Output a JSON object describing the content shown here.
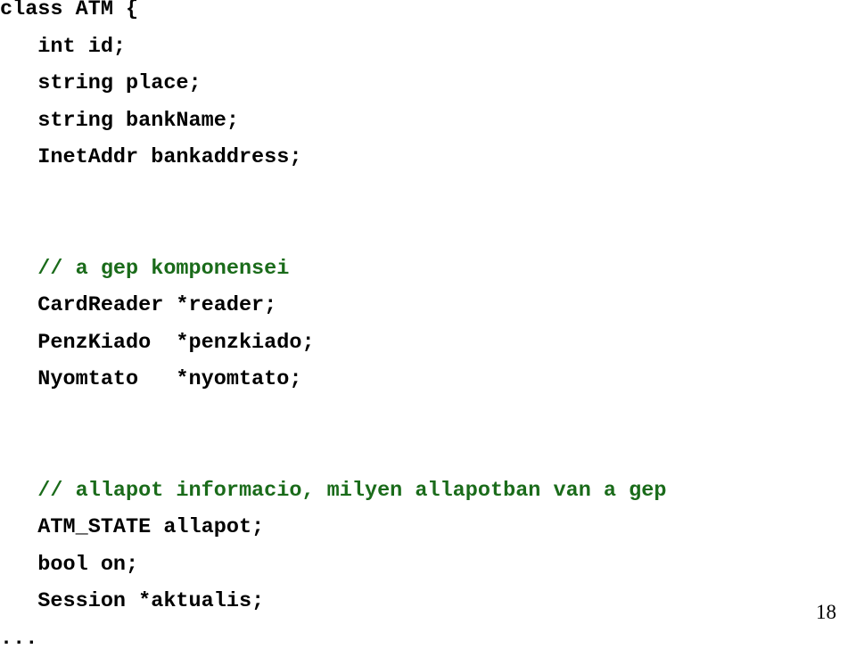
{
  "slide": {
    "background_color": "#ffffff",
    "text_color": "#000000",
    "comment_color": "#1a6b1a",
    "page_number": "18",
    "language": "cpp",
    "code_lines": [
      {
        "text": "class ATM {",
        "kind": "code"
      },
      {
        "text": "   int id;",
        "kind": "code"
      },
      {
        "text": "   string place;",
        "kind": "code"
      },
      {
        "text": "   string bankName;",
        "kind": "code"
      },
      {
        "text": "   InetAddr bankaddress;",
        "kind": "code"
      },
      {
        "text": " ",
        "kind": "blank"
      },
      {
        "text": " ",
        "kind": "blank"
      },
      {
        "text": "   // a gep komponensei",
        "kind": "comment"
      },
      {
        "text": "   CardReader *reader;",
        "kind": "code"
      },
      {
        "text": "   PenzKiado  *penzkiado;",
        "kind": "code"
      },
      {
        "text": "   Nyomtato   *nyomtato;",
        "kind": "code"
      },
      {
        "text": " ",
        "kind": "blank"
      },
      {
        "text": " ",
        "kind": "blank"
      },
      {
        "text": "   // allapot informacio, milyen allapotban van a gep",
        "kind": "comment"
      },
      {
        "text": "   ATM_STATE allapot;",
        "kind": "code"
      },
      {
        "text": "   bool on;",
        "kind": "code"
      },
      {
        "text": "   Session *aktualis;",
        "kind": "code"
      },
      {
        "text": "...",
        "kind": "code"
      }
    ]
  }
}
